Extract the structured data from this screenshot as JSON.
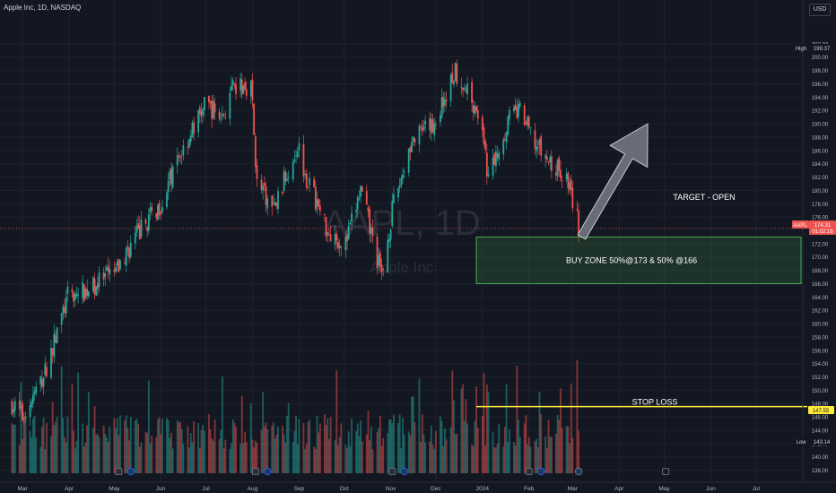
{
  "header": {
    "symbol_title": "Apple Inc, 1D, NASDAQ",
    "currency": "USD"
  },
  "watermark": {
    "ticker": "AAPL, 1D",
    "company": "Apple Inc"
  },
  "colors": {
    "up": "#26a69a",
    "down": "#ef5350",
    "background": "#131722",
    "zone": "#4caf50",
    "stop": "#ffeb3b"
  },
  "chart_data": {
    "type": "candlestick",
    "x_ticks": [
      "Mar",
      "Apr",
      "May",
      "Jun",
      "Jul",
      "Aug",
      "Sep",
      "Oct",
      "Nov",
      "Dec",
      "2024",
      "Feb",
      "Mar",
      "Apr",
      "May",
      "Jun",
      "Jul"
    ],
    "y_ticks": [
      138,
      140,
      142,
      144,
      146,
      148,
      150,
      152,
      154,
      156,
      158,
      160,
      162,
      164,
      166,
      168,
      170,
      172,
      174,
      176,
      178,
      180,
      182,
      184,
      186,
      188,
      190,
      192,
      194,
      196,
      198,
      200,
      202
    ],
    "ylim": [
      137,
      204
    ],
    "price_path": [
      [
        "2023-02-22",
        148
      ],
      [
        "2023-03-01",
        146
      ],
      [
        "2023-03-15",
        152
      ],
      [
        "2023-03-31",
        164
      ],
      [
        "2023-04-13",
        165
      ],
      [
        "2023-05-03",
        168
      ],
      [
        "2023-05-15",
        173
      ],
      [
        "2023-06-01",
        178
      ],
      [
        "2023-06-15",
        186
      ],
      [
        "2023-07-01",
        193
      ],
      [
        "2023-07-12",
        191
      ],
      [
        "2023-07-19",
        195
      ],
      [
        "2023-07-31",
        196
      ],
      [
        "2023-08-04",
        181
      ],
      [
        "2023-08-15",
        177
      ],
      [
        "2023-08-31",
        187
      ],
      [
        "2023-09-06",
        182
      ],
      [
        "2023-09-20",
        174
      ],
      [
        "2023-10-02",
        172
      ],
      [
        "2023-10-12",
        180
      ],
      [
        "2023-10-26",
        167
      ],
      [
        "2023-11-02",
        177
      ],
      [
        "2023-11-14",
        187
      ],
      [
        "2023-11-30",
        190
      ],
      [
        "2023-12-14",
        198
      ],
      [
        "2023-12-29",
        192
      ],
      [
        "2024-01-05",
        182
      ],
      [
        "2024-01-19",
        191
      ],
      [
        "2024-01-26",
        192
      ],
      [
        "2024-02-05",
        187
      ],
      [
        "2024-02-15",
        184
      ],
      [
        "2024-02-26",
        182
      ],
      [
        "2024-03-04",
        176
      ],
      [
        "2024-03-05",
        174.31
      ]
    ],
    "last_price": {
      "label": "AAPL",
      "value": "174.31",
      "countdown": "01:02:16"
    },
    "high_marker": {
      "label": "High",
      "value": "199.37"
    },
    "low_marker": {
      "label": "Low",
      "value": "143.14"
    },
    "buy_zone": {
      "label": "BUY ZONE 50%@173 & 50% @166",
      "upper": 173,
      "lower": 166,
      "start": "2023-12-28",
      "end": "2024-07-31"
    },
    "stop_loss": {
      "label": "STOP LOSS",
      "value": 147.55,
      "value_label": "147.55",
      "start": "2023-12-28"
    },
    "target_label": "TARGET - OPEN",
    "target_arrow": {
      "from": [
        "2024-03-07",
        173
      ],
      "to": [
        "2024-04-20",
        190
      ]
    },
    "volume": {
      "ylim": [
        0,
        100
      ],
      "peak_day": "2024-03-04"
    }
  }
}
